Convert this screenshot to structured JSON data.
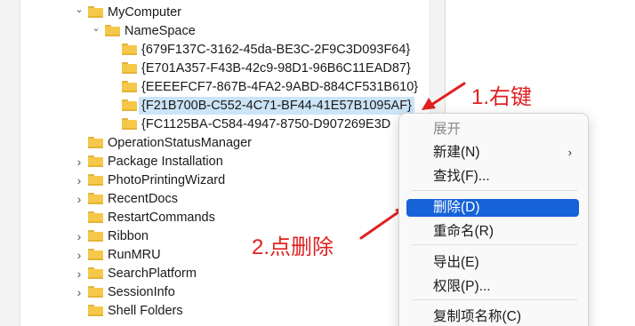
{
  "tree": {
    "items": [
      {
        "label": "MyComputer",
        "expander": "open"
      },
      {
        "label": "NameSpace",
        "expander": "open"
      },
      {
        "label": "{679F137C-3162-45da-BE3C-2F9C3D093F64}",
        "expander": ""
      },
      {
        "label": "{E701A357-F43B-42c9-98D1-96B6C11EAD87}",
        "expander": ""
      },
      {
        "label": "{EEEEFCF7-867B-4FA2-9ABD-884CF531B610}",
        "expander": ""
      },
      {
        "label": "{F21B700B-C552-4C71-BF44-41E57B1095AF}",
        "expander": "",
        "selected": true
      },
      {
        "label": "{FC1125BA-C584-4947-8750-D907269E3D",
        "expander": ""
      },
      {
        "label": "OperationStatusManager",
        "expander": ""
      },
      {
        "label": "Package Installation",
        "expander": "closed"
      },
      {
        "label": "PhotoPrintingWizard",
        "expander": "closed"
      },
      {
        "label": "RecentDocs",
        "expander": "closed"
      },
      {
        "label": "RestartCommands",
        "expander": ""
      },
      {
        "label": "Ribbon",
        "expander": "closed"
      },
      {
        "label": "RunMRU",
        "expander": "closed"
      },
      {
        "label": "SearchPlatform",
        "expander": "closed"
      },
      {
        "label": "SessionInfo",
        "expander": "closed"
      },
      {
        "label": "Shell Folders",
        "expander": ""
      }
    ]
  },
  "context_menu": {
    "items": [
      {
        "label": "展开",
        "state": "disabled"
      },
      {
        "label": "新建(N)",
        "state": "normal",
        "submenu": "›"
      },
      {
        "label": "查找(F)...",
        "state": "normal"
      },
      {
        "label": "删除(D)",
        "state": "highlight"
      },
      {
        "label": "重命名(R)",
        "state": "normal"
      },
      {
        "label": "导出(E)",
        "state": "normal"
      },
      {
        "label": "权限(P)...",
        "state": "normal"
      },
      {
        "label": "复制项名称(C)",
        "state": "normal"
      }
    ]
  },
  "annotations": {
    "step1": "1.右键",
    "step2": "2.点删除",
    "color": "#e02020"
  },
  "colors": {
    "folder": "#f5c84a",
    "selection": "#cce4f7",
    "menu_highlight": "#1662d8"
  }
}
